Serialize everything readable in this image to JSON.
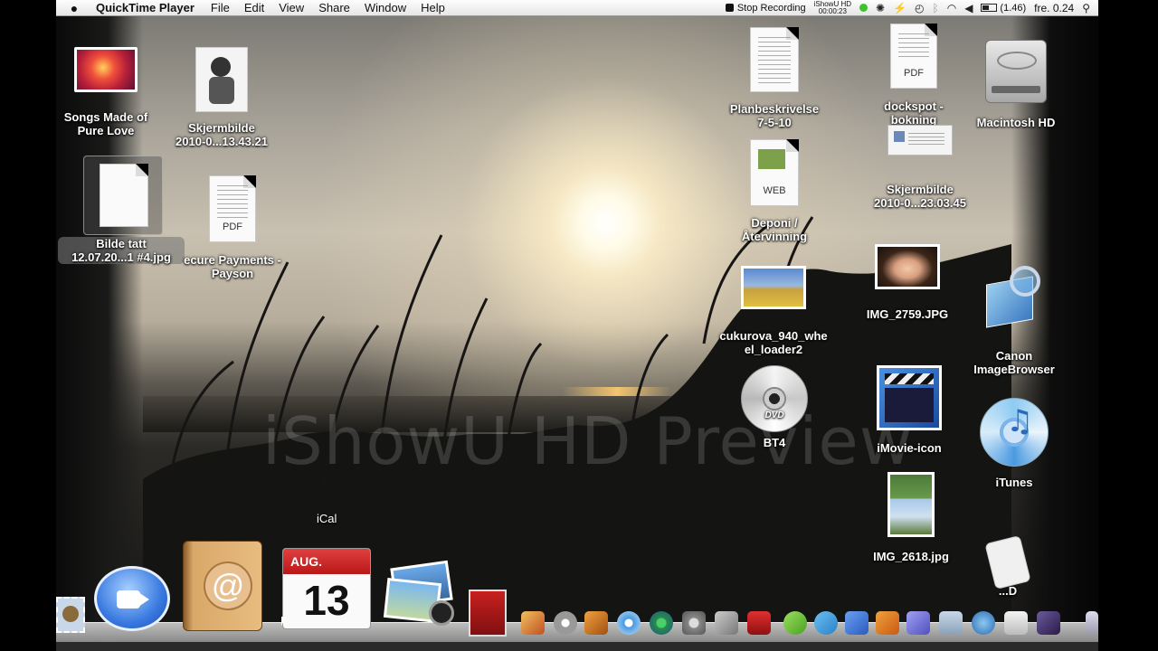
{
  "menubar": {
    "app_name": "QuickTime Player",
    "menus": [
      "File",
      "Edit",
      "View",
      "Share",
      "Window",
      "Help"
    ],
    "stop_recording": "Stop Recording",
    "ishowu_line1": "iShowU HD",
    "ishowu_time": "00:00:23",
    "battery_time": "(1.46)",
    "clock": "fre. 0.24"
  },
  "desktop_icons": {
    "songs": "Songs Made of\nPure Love",
    "skjermbilde1": "Skjermbilde\n2010-0...13.43.21",
    "bilde_tatt": "Bilde tatt\n12.07.20...1 #4.jpg",
    "secure_payments": "ecure Payments -\nPayson",
    "planbeskrivelse": "Planbeskrivelse\n7-5-10",
    "dockspot": "dockspot -\nbokning",
    "macintosh_hd": "Macintosh HD",
    "skjermbilde2": "Skjermbilde\n2010-0...23.03.45",
    "deponi": "Deponi /\nÅtervinning",
    "cukurova": "cukurova_940_whe\nel_loader2",
    "img_2759": "IMG_2759.JPG",
    "canon": "Canon\nImageBrowser",
    "bt4": "BT4",
    "imovie_icon": "iMovie-icon",
    "itunes": "iTunes",
    "img_2618": "IMG_2618.jpg",
    "partial": "...D"
  },
  "doc_tags": {
    "pdf": "PDF",
    "web": "WEB",
    "dvd": "DVD"
  },
  "watermark": "iShowU HD Preview",
  "dock": {
    "tooltip": "iCal",
    "ical_month": "AUG.",
    "ical_day": "13"
  },
  "colors": {
    "menubar": "#e8e8e8",
    "dock_shelf": "#c8c8c8",
    "sun": "#fffbe8"
  }
}
